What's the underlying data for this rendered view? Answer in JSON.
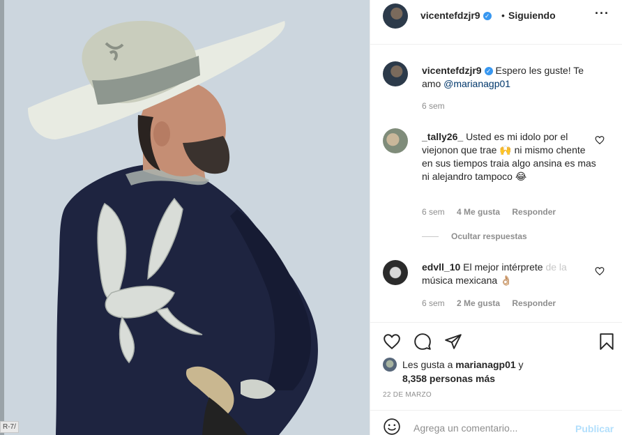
{
  "post": {
    "author": "vicentefdzjr9",
    "separator": "•",
    "follow_status": "Siguiendo",
    "more_label": "···"
  },
  "colors": {
    "verified": "#3897f0",
    "mention": "#00376b",
    "muted": "#8e8e8e",
    "publish_disabled": "#b2dffc",
    "photo_background": "#ccd6de",
    "jacket": "#1e2440"
  },
  "icons": {
    "verified": "verified-badge-icon",
    "more": "more-options-icon",
    "like": "heart-icon",
    "comment": "comment-bubble-icon",
    "share": "paper-plane-icon",
    "save": "bookmark-icon",
    "emoji": "emoji-smiley-icon"
  },
  "caption": {
    "username": "vicentefdzjr9",
    "text": "Espero les guste! Te amo",
    "mention": "@marianagp01",
    "time": "6 sem"
  },
  "comments": [
    {
      "username": "_tally26_",
      "text": "Usted es mi idolo por el viejonon que trae 🙌 ni mismo chente en sus tiempos traia algo ansina es mas ni alejandro tampoco 😂",
      "time": "6 sem",
      "likes": "4 Me gusta",
      "reply": "Responder"
    },
    {
      "username": "edvll_10",
      "text": "El mejor intérprete",
      "text_faded": "de la",
      "text_cont": "música mexicana 👌🏼",
      "time": "6 sem",
      "likes": "2 Me gusta",
      "reply": "Responder"
    }
  ],
  "hide_replies": "Ocultar respuestas",
  "likes": {
    "prefix": "Les gusta a",
    "user": "marianagp01",
    "connector": "y",
    "others": "8,358 personas más"
  },
  "date": "22 DE MARZO",
  "add_comment": {
    "placeholder": "Agrega un comentario...",
    "publish": "Publicar"
  },
  "edge_label": "R-7/"
}
